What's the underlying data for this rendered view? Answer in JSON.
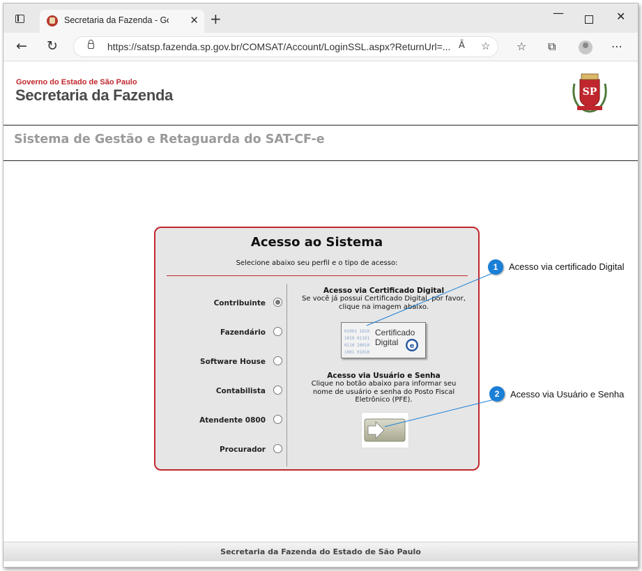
{
  "browser": {
    "tab_title": "Secretaria da Fazenda - Governo do Estado de São Paulo",
    "tab_close": "✕",
    "new_tab": "+",
    "url": "https://satsp.fazenda.sp.gov.br/COMSAT/Account/LoginSSL.aspx?ReturnUrl=...",
    "read_aloud": "Ã",
    "more_menu": "⋯"
  },
  "header": {
    "gov_line": "Governo do Estado de São Paulo",
    "sec_line": "Secretaria da Fazenda",
    "crest_text": "SP"
  },
  "system_title": "Sistema de Gestão e Retaguarda do SAT-CF-e",
  "panel": {
    "title": "Acesso ao Sistema",
    "subtitle": "Selecione abaixo seu perfil e o tipo de acesso:",
    "profiles": [
      {
        "label": "Contribuinte",
        "selected": true
      },
      {
        "label": "Fazendário",
        "selected": false
      },
      {
        "label": "Software House",
        "selected": false
      },
      {
        "label": "Contabilista",
        "selected": false
      },
      {
        "label": "Atendente 0800",
        "selected": false
      },
      {
        "label": "Procurador",
        "selected": false
      }
    ],
    "cert": {
      "title": "Acesso via Certificado Digital",
      "desc": "Se você já possui Certificado Digital, por favor, clique na imagem abaixo.",
      "button_word1": "Certificado",
      "button_word2": "Digital",
      "button_badge": "e"
    },
    "user": {
      "title": "Acesso via Usuário e Senha",
      "desc": "Clique no botão abaixo para informar seu nome de usuário e senha do Posto Fiscal Eletrônico (PFE)."
    }
  },
  "callouts": [
    {
      "number": "1",
      "text": "Acesso via certificado Digital"
    },
    {
      "number": "2",
      "text": "Acesso via Usuário e Senha"
    }
  ],
  "footer": "Secretaria da Fazenda do Estado de São Paulo",
  "colors": {
    "accent_red": "#c0262d",
    "callout_blue": "#1a7fd6"
  }
}
